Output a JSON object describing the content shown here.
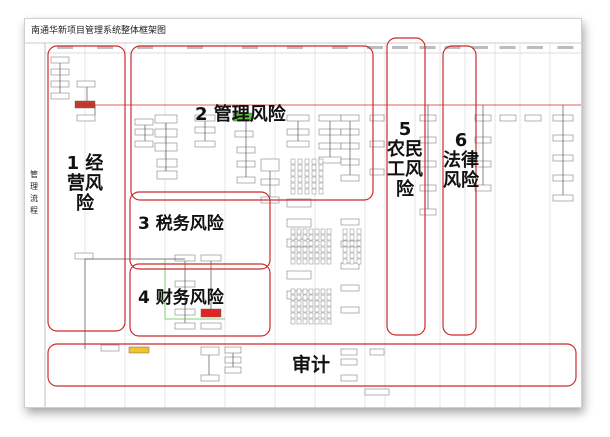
{
  "diagram": {
    "title": "南通华新项目管理系统整体框架图",
    "lane_label": "管理流程",
    "risk_labels": [
      {
        "id": "r1",
        "lines": [
          "1 经",
          "营风",
          "险"
        ]
      },
      {
        "id": "r2",
        "lines": [
          "2 管理风险"
        ]
      },
      {
        "id": "r3",
        "lines": [
          "3 税务风险"
        ]
      },
      {
        "id": "r4",
        "lines": [
          "4 财务风险"
        ]
      },
      {
        "id": "r5",
        "lines": [
          "5",
          "农民",
          "工风",
          "险"
        ]
      },
      {
        "id": "r6",
        "lines": [
          "6",
          "法律",
          "风险"
        ]
      },
      {
        "id": "audit",
        "lines": [
          "审计"
        ]
      }
    ],
    "colors": {
      "frame": "#cc2b2b",
      "flow_line": "#cc2b2b",
      "box_border": "#6b6b6b",
      "highlight_red": "#e32222",
      "highlight_green": "#5fbf44",
      "highlight_yellow": "#f2c230",
      "dark_box": "#c0392b"
    }
  }
}
